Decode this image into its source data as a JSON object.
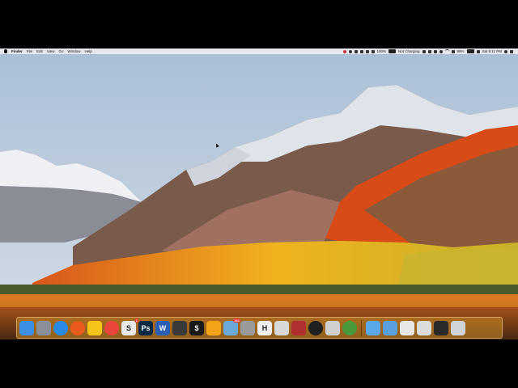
{
  "menubar": {
    "items": [
      "Finder",
      "File",
      "Edit",
      "View",
      "Go",
      "Window",
      "Help"
    ],
    "right": {
      "battery_pct": "100%",
      "status": "Not Charging",
      "wifi_pct": "99%",
      "clock": "Sat 6:11 PM"
    }
  },
  "dock": {
    "apps": [
      {
        "name": "finder-icon",
        "bg": "#3d8fe6",
        "glyph": ""
      },
      {
        "name": "launchpad-icon",
        "bg": "#8a8f99",
        "glyph": ""
      },
      {
        "name": "safari-icon",
        "bg": "#2a8ae8",
        "glyph": ""
      },
      {
        "name": "firefox-icon",
        "bg": "#e85b1d",
        "glyph": ""
      },
      {
        "name": "lightbulb-icon",
        "bg": "#f5c418",
        "glyph": ""
      },
      {
        "name": "chrome-icon",
        "bg": "#e9473b",
        "glyph": ""
      },
      {
        "name": "s-app-icon",
        "bg": "#e8e8e8",
        "glyph": "S",
        "badge": "1"
      },
      {
        "name": "photoshop-icon",
        "bg": "#0a2a44",
        "glyph": "Ps"
      },
      {
        "name": "word-icon",
        "bg": "#2b5fb4",
        "glyph": "W"
      },
      {
        "name": "pencil-app-icon",
        "bg": "#3a3a3a",
        "glyph": ""
      },
      {
        "name": "terminal-icon",
        "bg": "#1a1a1a",
        "glyph": "$"
      },
      {
        "name": "vlc-icon",
        "bg": "#f2a318",
        "glyph": ""
      },
      {
        "name": "photos-app-icon",
        "bg": "#6aa8d8",
        "glyph": "",
        "badge": "161"
      },
      {
        "name": "system-preferences-icon",
        "bg": "#9a9a9a",
        "glyph": ""
      },
      {
        "name": "h-app-icon",
        "bg": "#f0f0f0",
        "glyph": "H"
      },
      {
        "name": "preview-icon",
        "bg": "#d8d8d8",
        "glyph": ""
      },
      {
        "name": "chess-app-icon",
        "bg": "#b03030",
        "glyph": ""
      },
      {
        "name": "obs-icon",
        "bg": "#202020",
        "glyph": ""
      },
      {
        "name": "image-app-icon",
        "bg": "#cfcfcf",
        "glyph": ""
      },
      {
        "name": "chrome-2-icon",
        "bg": "#4a9a3a",
        "glyph": ""
      }
    ],
    "folders": [
      {
        "name": "downloads-folder-icon",
        "bg": "#5aa8e8"
      },
      {
        "name": "documents-folder-icon",
        "bg": "#5aa0e0"
      },
      {
        "name": "window-thumb-1-icon",
        "bg": "#e8e8e8"
      },
      {
        "name": "window-thumb-2-icon",
        "bg": "#dcdcdc"
      },
      {
        "name": "window-thumb-3-icon",
        "bg": "#2a2a2a"
      },
      {
        "name": "trash-icon",
        "bg": "#d0d4d8"
      }
    ]
  }
}
